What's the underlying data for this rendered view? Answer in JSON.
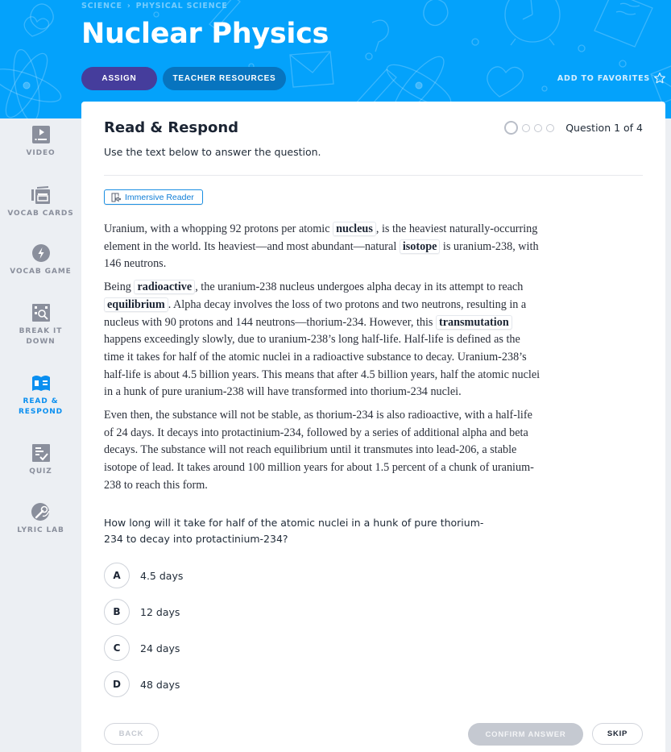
{
  "header": {
    "breadcrumb": [
      "SCIENCE",
      "PHYSICAL SCIENCE"
    ],
    "title": "Nuclear Physics",
    "assign_label": "ASSIGN",
    "teacher_resources_label": "TEACHER RESOURCES",
    "favorites_label": "ADD TO FAVORITES"
  },
  "sidebar": {
    "items": [
      {
        "label": "VIDEO",
        "icon": "video-icon"
      },
      {
        "label": "VOCAB CARDS",
        "icon": "vocab-cards-icon"
      },
      {
        "label": "VOCAB GAME",
        "icon": "lightning-icon"
      },
      {
        "label": "BREAK IT DOWN",
        "icon": "magnifier-icon"
      },
      {
        "label": "READ & RESPOND",
        "icon": "open-book-icon",
        "active": true
      },
      {
        "label": "QUIZ",
        "icon": "checklist-icon"
      },
      {
        "label": "LYRIC LAB",
        "icon": "microphone-icon"
      }
    ],
    "active_color": "#0a8ff0"
  },
  "card": {
    "title": "Read & Respond",
    "subtitle": "Use the text below to answer the question.",
    "progress": {
      "current": 1,
      "total": 4,
      "label": "Question 1 of 4"
    },
    "immersive_reader_label": "Immersive Reader"
  },
  "passage": {
    "p1": {
      "t1": "Uranium, with a whopping 92 protons per atomic ",
      "v1": "nucleus",
      "t2": ", is the heaviest naturally-occurring element in the world. Its heaviest—and most abundant—natural ",
      "v2": "isotope",
      "t3": " is uranium-238, with 146 neutrons."
    },
    "p2": {
      "t1": "Being ",
      "v1": "radioactive",
      "t2": ", the uranium-238 nucleus undergoes alpha decay in its attempt to reach ",
      "v2": "equilibrium",
      "t3": ". Alpha decay involves the loss of two protons and two neutrons, resulting in a nucleus with 90 protons and 144 neutrons—thorium-234. However, this ",
      "v3": "transmutation",
      "t4": " happens exceedingly slowly, due to uranium-238’s long half-life. Half-life is defined as the time it takes for half of the atomic nuclei in a radioactive substance to decay. Uranium-238’s half-life is about 4.5 billion years. This means that after 4.5 billion years, half the atomic nuclei in a hunk of pure uranium-238 will have transformed into thorium-234 nuclei."
    },
    "p3": "Even then, the substance will not be stable, as thorium-234 is also radioactive, with a half-life of 24 days. It decays into protactinium-234, followed by a series of additional alpha and beta decays. The substance will not reach equilibrium until it transmutes into lead-206, a stable isotope of lead. It takes around 100 million years for about 1.5 percent of a chunk of uranium-238 to reach this form."
  },
  "question": {
    "text": "How long will it take for half of the atomic nuclei in a hunk of pure thorium-234 to decay into protactinium-234?",
    "options": [
      {
        "letter": "A",
        "text": "4.5 days"
      },
      {
        "letter": "B",
        "text": "12 days"
      },
      {
        "letter": "C",
        "text": "24 days"
      },
      {
        "letter": "D",
        "text": "48 days"
      }
    ]
  },
  "footer": {
    "back_label": "BACK",
    "confirm_label": "CONFIRM ANSWER",
    "skip_label": "SKIP"
  }
}
